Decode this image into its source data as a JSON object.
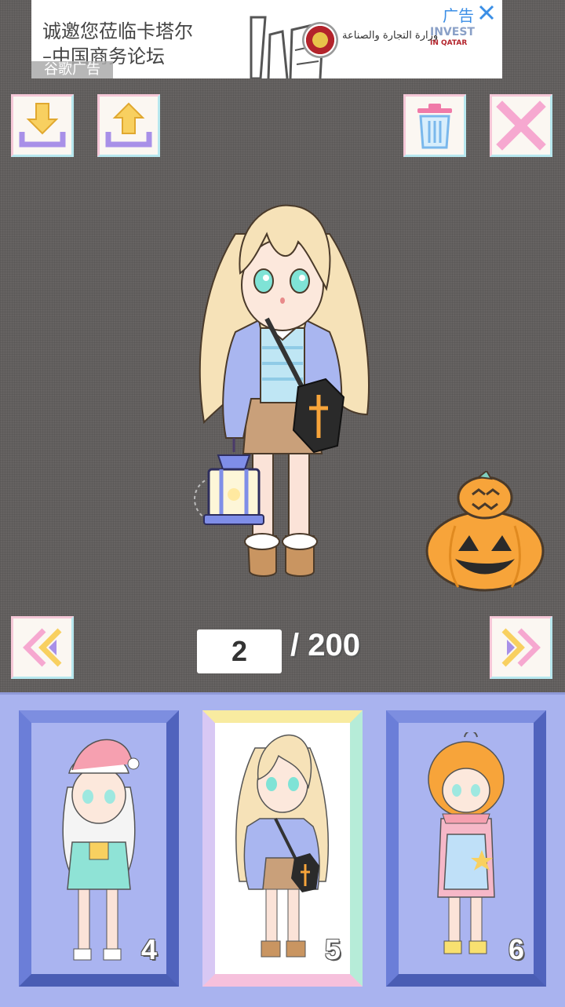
{
  "ad": {
    "text": "诚邀您莅临卡塔尔\n–中国商务论坛",
    "mark": "谷歌广告",
    "tag": "广告",
    "arabic": "وزارة التجارة والصناعة",
    "invest": "INVEST",
    "invest_sub": "IN QATAR"
  },
  "toolbar": {
    "download_icon": "download-icon",
    "upload_icon": "upload-icon",
    "trash_icon": "trash-icon",
    "close_icon": "close-icon"
  },
  "pager": {
    "current": "2",
    "total": "/ 200"
  },
  "slots": [
    {
      "number": "4"
    },
    {
      "number": "5"
    },
    {
      "number": "6"
    }
  ],
  "colors": {
    "background": "#666362",
    "tray": "#a9b3ef",
    "card_frame": "#5a6fc8",
    "pumpkin": "#f7a43a"
  }
}
